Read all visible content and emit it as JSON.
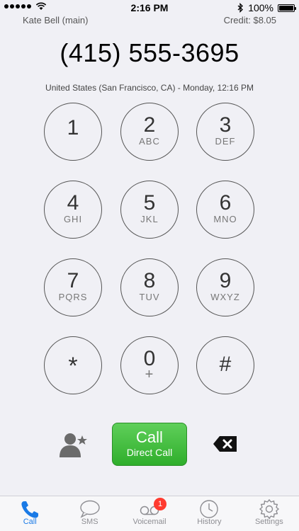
{
  "status_bar": {
    "time": "2:16 PM",
    "battery": "100%",
    "battery_level": 1.0,
    "signal_dots": 5
  },
  "account": {
    "name": "Kate Bell (main)",
    "credit": "Credit: $8.05"
  },
  "dialer": {
    "number": "(415) 555-3695",
    "location": "United States (San Francisco, CA) - Monday, 12:16 PM"
  },
  "keypad": [
    {
      "digit": "1",
      "letters": ""
    },
    {
      "digit": "2",
      "letters": "ABC"
    },
    {
      "digit": "3",
      "letters": "DEF"
    },
    {
      "digit": "4",
      "letters": "GHI"
    },
    {
      "digit": "5",
      "letters": "JKL"
    },
    {
      "digit": "6",
      "letters": "MNO"
    },
    {
      "digit": "7",
      "letters": "PQRS"
    },
    {
      "digit": "8",
      "letters": "TUV"
    },
    {
      "digit": "9",
      "letters": "WXYZ"
    },
    {
      "digit": "*",
      "letters": ""
    },
    {
      "digit": "0",
      "letters": "+"
    },
    {
      "digit": "#",
      "letters": ""
    }
  ],
  "actions": {
    "call_label": "Call",
    "call_sub": "Direct Call",
    "contact_icon": "add-contact-icon",
    "backspace_icon": "backspace-icon"
  },
  "tabs": [
    {
      "label": "Call",
      "icon": "phone-icon",
      "active": true
    },
    {
      "label": "SMS",
      "icon": "chat-bubble-icon",
      "active": false
    },
    {
      "label": "Voicemail",
      "icon": "voicemail-icon",
      "active": false,
      "badge": "1"
    },
    {
      "label": "History",
      "icon": "clock-icon",
      "active": false
    },
    {
      "label": "Settings",
      "icon": "gear-icon",
      "active": false
    }
  ],
  "colors": {
    "accent": "#1a7ae6",
    "call_green": "#3dbb38",
    "badge_red": "#ff3b30",
    "background": "#f0f0f5"
  }
}
